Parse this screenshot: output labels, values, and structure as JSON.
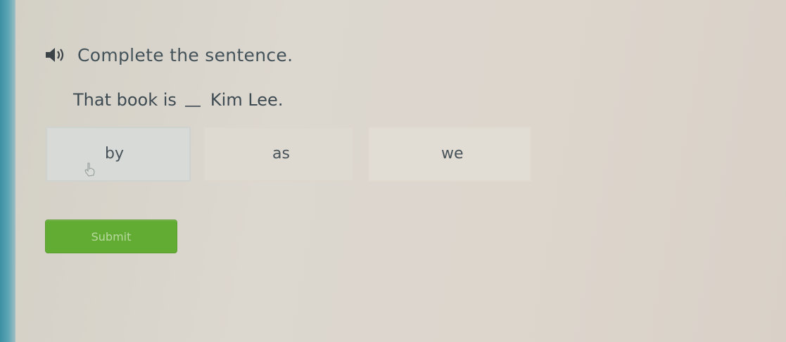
{
  "colors": {
    "accent_rail": "#3b8fa3",
    "submit_green": "#63ac34",
    "text": "#3f4a50"
  },
  "icons": {
    "audio": "speaker-icon",
    "cursor": "hand-cursor-icon"
  },
  "question": {
    "instruction": "Complete the sentence.",
    "sentence_before": "That book is",
    "sentence_after": "Kim Lee.",
    "choices": [
      {
        "label": "by"
      },
      {
        "label": "as"
      },
      {
        "label": "we"
      }
    ],
    "submit_label": "Submit"
  }
}
